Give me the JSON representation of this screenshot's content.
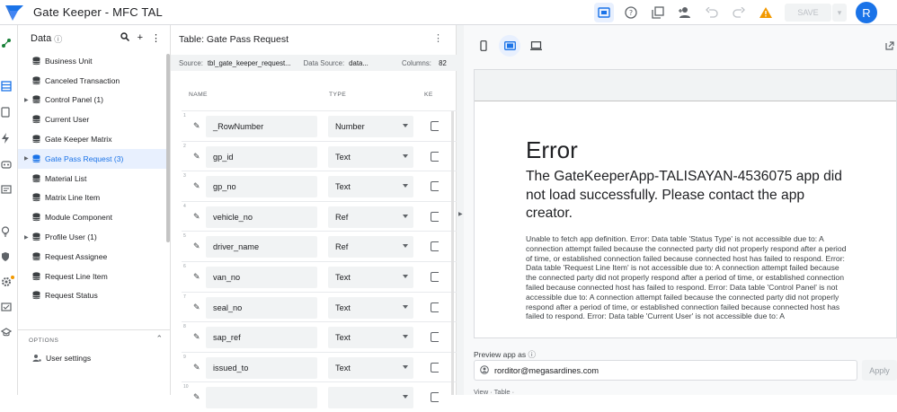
{
  "app": {
    "title": "Gate Keeper - MFC TAL",
    "avatar_letter": "R",
    "save_label": "SAVE"
  },
  "colors": {
    "accent": "#1a73e8",
    "warning": "#f29900",
    "selected_bg": "#e8f0fe"
  },
  "data_panel": {
    "title": "Data",
    "items": [
      {
        "label": "Business Unit"
      },
      {
        "label": "Canceled Transaction"
      },
      {
        "label": "Control Panel (1)"
      },
      {
        "label": "Current User"
      },
      {
        "label": "Gate Keeper Matrix"
      },
      {
        "label": "Gate Pass Request (3)"
      },
      {
        "label": "Material List"
      },
      {
        "label": "Matrix Line Item"
      },
      {
        "label": "Module Component"
      },
      {
        "label": "Profile User (1)"
      },
      {
        "label": "Request Assignee"
      },
      {
        "label": "Request Line Item"
      },
      {
        "label": "Request Status"
      }
    ],
    "options_label": "OPTIONS",
    "user_settings": "User settings"
  },
  "table_panel": {
    "title": "Table: Gate Pass Request",
    "source_label": "Source:",
    "source_value": "tbl_gate_keeper_request...",
    "datasource_label": "Data Source:",
    "datasource_value": "data...",
    "columns_label": "Columns:",
    "columns_value": "82",
    "headers": {
      "name": "NAME",
      "type": "TYPE",
      "key": "KE"
    },
    "rows": [
      {
        "num": "1",
        "name": "_RowNumber",
        "type": "Number"
      },
      {
        "num": "2",
        "name": "gp_id",
        "type": "Text"
      },
      {
        "num": "3",
        "name": "gp_no",
        "type": "Text"
      },
      {
        "num": "4",
        "name": "vehicle_no",
        "type": "Ref"
      },
      {
        "num": "5",
        "name": "driver_name",
        "type": "Ref"
      },
      {
        "num": "6",
        "name": "van_no",
        "type": "Text"
      },
      {
        "num": "7",
        "name": "seal_no",
        "type": "Text"
      },
      {
        "num": "8",
        "name": "sap_ref",
        "type": "Text"
      },
      {
        "num": "9",
        "name": "issued_to",
        "type": "Text"
      },
      {
        "num": "10",
        "name": "",
        "type": ""
      }
    ]
  },
  "preview": {
    "error_title": "Error",
    "error_subtitle": "The GateKeeperApp-TALISAYAN-4536075 app did not load successfully. Please contact the app creator.",
    "error_body": "Unable to fetch app definition. Error: Data table 'Status Type' is not accessible due to: A connection attempt failed because the connected party did not properly respond after a period of time, or established connection failed because connected host has failed to respond. Error: Data table 'Request Line Item' is not accessible due to: A connection attempt failed because the connected party did not properly respond after a period of time, or established connection failed because connected host has failed to respond. Error: Data table 'Control Panel' is not accessible due to: A connection attempt failed because the connected party did not properly respond after a period of time, or established connection failed because connected host has failed to respond. Error: Data table 'Current User' is not accessible due to: A",
    "preview_as_label": "Preview app as",
    "preview_email": "rorditor@megasardines.com",
    "apply_label": "Apply",
    "bottom_labels": "View · Table ·"
  }
}
